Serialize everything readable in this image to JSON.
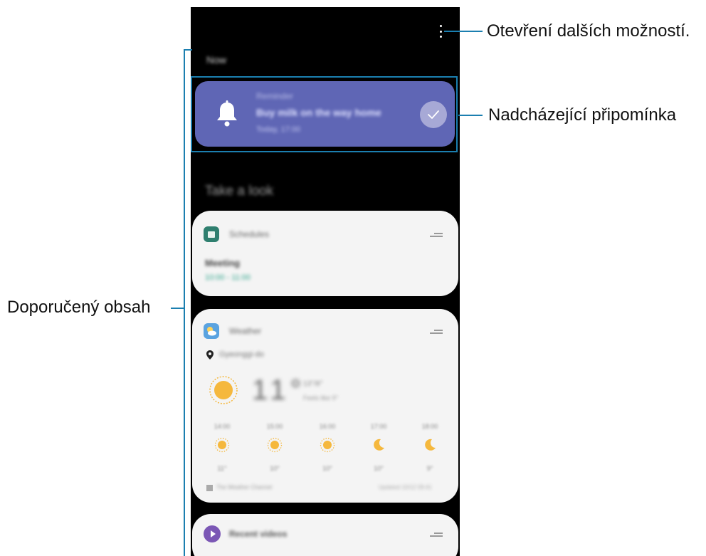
{
  "callouts": {
    "more_options": "Otevření dalších možností.",
    "upcoming_reminder": "Nadcházející připomínka",
    "recommended_content": "Doporučený obsah"
  },
  "screen": {
    "now_label": "Now",
    "reminder": {
      "category": "Reminder",
      "title": "Buy milk on the way home",
      "time": "Today, 17:00"
    },
    "section_title": "Take a look",
    "schedule_card": {
      "title": "Schedules",
      "event": "Meeting",
      "time": "10:00 - 11:00"
    },
    "weather_card": {
      "title": "Weather",
      "location": "Gyeonggi-do",
      "temperature": "11°",
      "details_top": "13°/8°",
      "details_bottom": "Feels like 9°",
      "forecast": [
        {
          "time": "14:00",
          "icon": "sun-icon",
          "temp": "11°"
        },
        {
          "time": "15:00",
          "icon": "sun-icon",
          "temp": "10°"
        },
        {
          "time": "16:00",
          "icon": "sun-icon",
          "temp": "10°"
        },
        {
          "time": "17:00",
          "icon": "moon-icon",
          "temp": "10°"
        },
        {
          "time": "18:00",
          "icon": "moon-icon",
          "temp": "9°"
        }
      ],
      "source": "The Weather Channel",
      "updated": "Updated 10/12 09:41"
    },
    "videos_card": {
      "title": "Recent videos"
    }
  },
  "colors": {
    "accent_line": "#1b7fb0",
    "reminder_bg": "#5f66b5",
    "schedule_icon": "#2f7f6f",
    "weather_icon": "#5aa3e0",
    "video_icon": "#7b57b5",
    "sun": "#f5b83d"
  }
}
